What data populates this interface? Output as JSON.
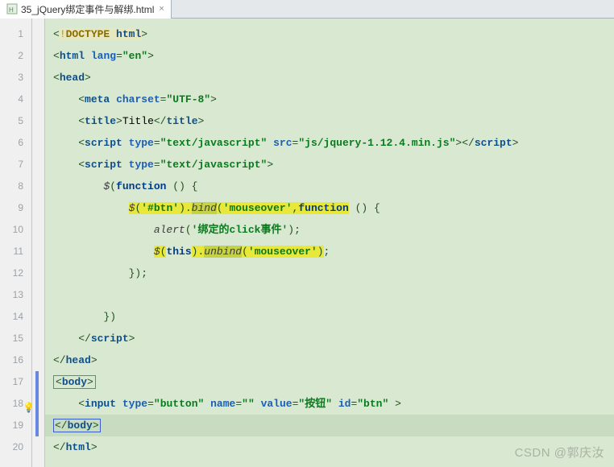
{
  "tab": {
    "filename": "35_jQuery绑定事件与解绑.html"
  },
  "gutter": {
    "lines": [
      "1",
      "2",
      "3",
      "4",
      "5",
      "6",
      "7",
      "8",
      "9",
      "10",
      "11",
      "12",
      "13",
      "14",
      "15",
      "16",
      "17",
      "18",
      "19",
      "20"
    ]
  },
  "code": {
    "l1": {
      "doctype": "DOCTYPE",
      "html": "html"
    },
    "l2": {
      "open": "html",
      "attr": "lang",
      "val": "\"en\""
    },
    "l3": {
      "open": "head"
    },
    "l4": {
      "tag": "meta",
      "attr": "charset",
      "val": "\"UTF-8\""
    },
    "l5": {
      "tag": "title",
      "text": "Title"
    },
    "l6": {
      "tag": "script",
      "attr1": "type",
      "val1": "\"text/javascript\"",
      "attr2": "src",
      "val2": "\"js/jquery-1.12.4.min.js\""
    },
    "l7": {
      "tag": "script",
      "attr1": "type",
      "val1": "\"text/javascript\""
    },
    "l8": {
      "jq": "$",
      "fn": "function",
      "paren": " () {"
    },
    "l9": {
      "jq": "$",
      "sel": "'#btn'",
      "bind": "bind",
      "evt": "'mouseover'",
      "fn": "function",
      "tail": " () {"
    },
    "l10": {
      "alert": "alert",
      "str": "'绑定的click事件'"
    },
    "l11": {
      "jq": "$",
      "this": "this",
      "unbind": "unbind",
      "evt": "'mouseover'"
    },
    "l12": {
      "close": "});"
    },
    "l14": {
      "close": "})"
    },
    "l15": {
      "tag": "script"
    },
    "l16": {
      "tag": "head"
    },
    "l17": {
      "tag": "body"
    },
    "l18": {
      "tag": "input",
      "attr1": "type",
      "val1": "\"button\"",
      "attr2": "name",
      "val2": "\"\"",
      "attr3": "value",
      "val3": "\"按钮\"",
      "attr4": "id",
      "val4": "\"btn\""
    },
    "l19": {
      "tag": "body"
    },
    "l20": {
      "tag": "html"
    }
  },
  "watermark": "CSDN @郭庆汝"
}
